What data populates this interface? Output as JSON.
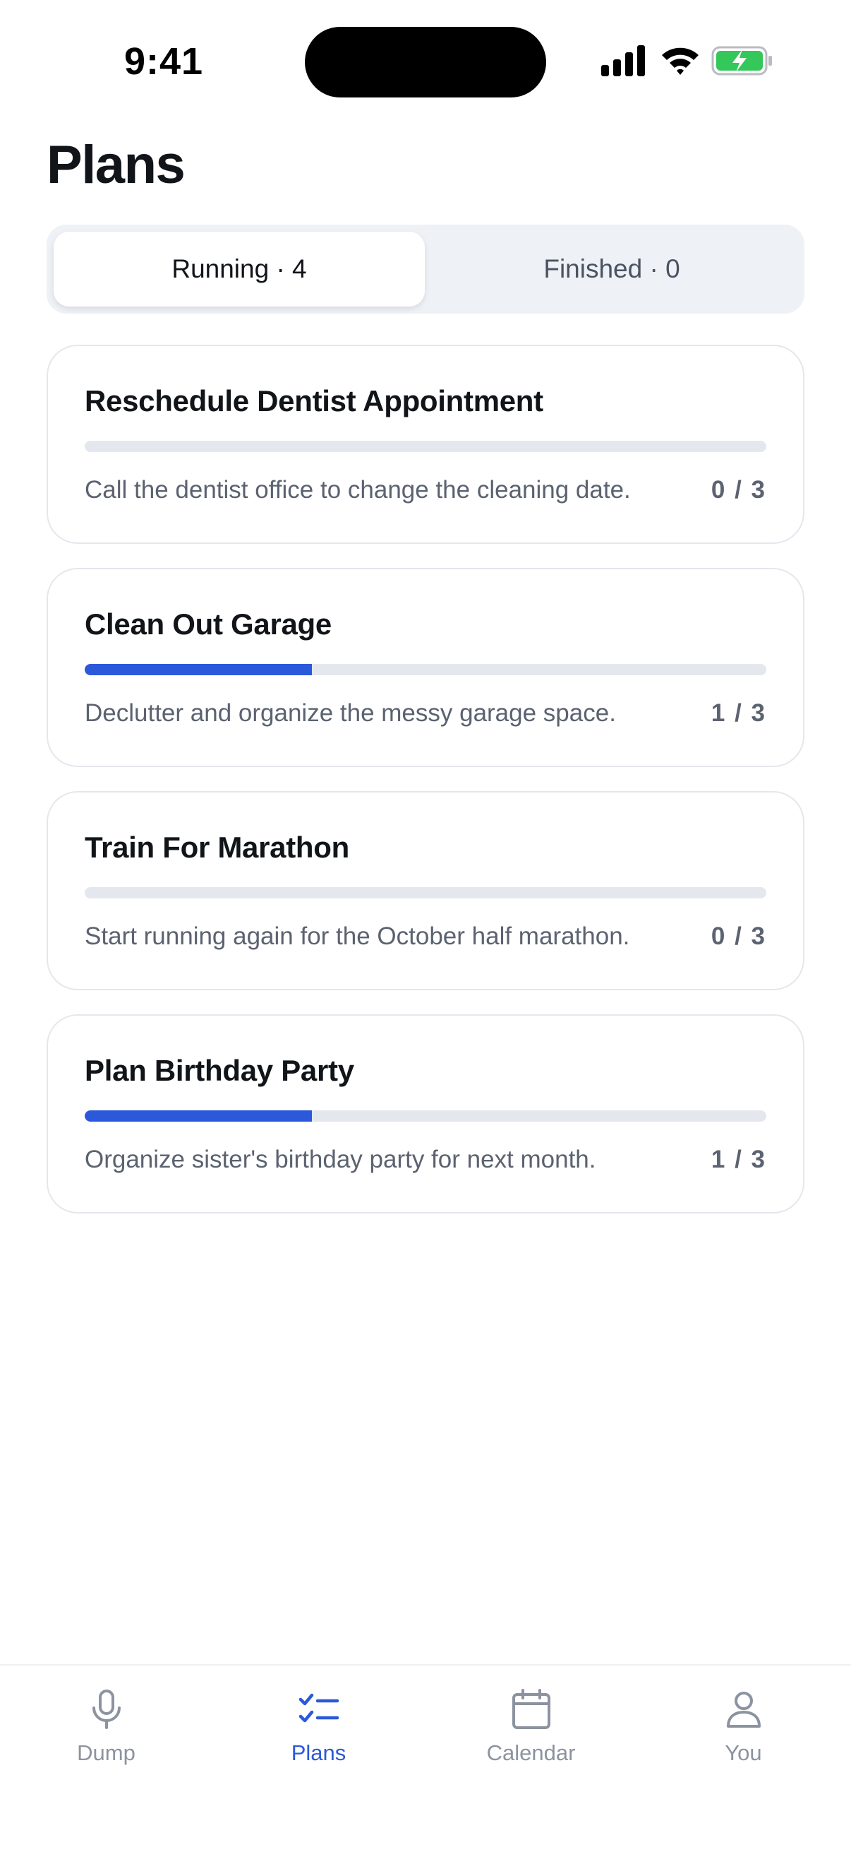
{
  "status_bar": {
    "time": "9:41"
  },
  "page": {
    "title": "Plans"
  },
  "tabs": {
    "running": "Running · 4",
    "finished": "Finished · 0"
  },
  "plans": [
    {
      "title": "Reschedule Dentist Appointment",
      "description": "Call the dentist office to change the cleaning date.",
      "count": "0 / 3",
      "progress": 0
    },
    {
      "title": "Clean Out Garage",
      "description": "Declutter and organize the messy garage space.",
      "count": "1 / 3",
      "progress": 0.3333
    },
    {
      "title": "Train For Marathon",
      "description": "Start running again for the October half marathon.",
      "count": "0 / 3",
      "progress": 0
    },
    {
      "title": "Plan Birthday Party",
      "description": "Organize sister's birthday party for next month.",
      "count": "1 / 3",
      "progress": 0.3333
    }
  ],
  "tab_bar": {
    "items": [
      {
        "label": "Dump",
        "icon": "microphone-icon",
        "active": false
      },
      {
        "label": "Plans",
        "icon": "checklist-icon",
        "active": true
      },
      {
        "label": "Calendar",
        "icon": "calendar-icon",
        "active": false
      },
      {
        "label": "You",
        "icon": "person-icon",
        "active": false
      }
    ]
  },
  "colors": {
    "accent": "#2b59d9",
    "inactive_tab": "#8c93a0",
    "battery": "#34c759"
  }
}
